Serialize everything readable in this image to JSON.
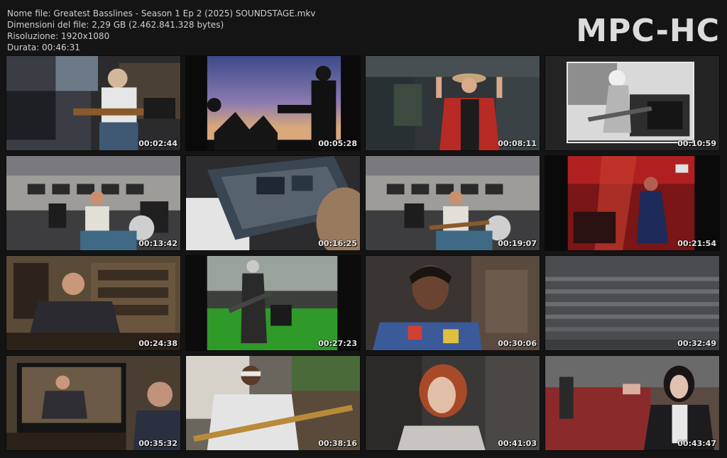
{
  "file_info": {
    "name": "Nome file: Greatest Basslines - Season 1 Ep 2 (2025) SOUNDSTAGE.mkv",
    "size": "Dimensioni del file: 2,29 GB (2.462.841.328 bytes)",
    "resolution": "Risoluzione: 1920x1080",
    "duration": "Durata: 00:46:31"
  },
  "logo": "MPC-HC",
  "thumbnails": [
    {
      "time": "00:02:44"
    },
    {
      "time": "00:05:28"
    },
    {
      "time": "00:08:11"
    },
    {
      "time": "00:10:59"
    },
    {
      "time": "00:13:42"
    },
    {
      "time": "00:16:25"
    },
    {
      "time": "00:19:07"
    },
    {
      "time": "00:21:54"
    },
    {
      "time": "00:24:38"
    },
    {
      "time": "00:27:23"
    },
    {
      "time": "00:30:06"
    },
    {
      "time": "00:32:49"
    },
    {
      "time": "00:35:32"
    },
    {
      "time": "00:38:16"
    },
    {
      "time": "00:41:03"
    },
    {
      "time": "00:43:47"
    }
  ],
  "colors": {
    "background": "#141414",
    "text": "#cfcfcf"
  }
}
